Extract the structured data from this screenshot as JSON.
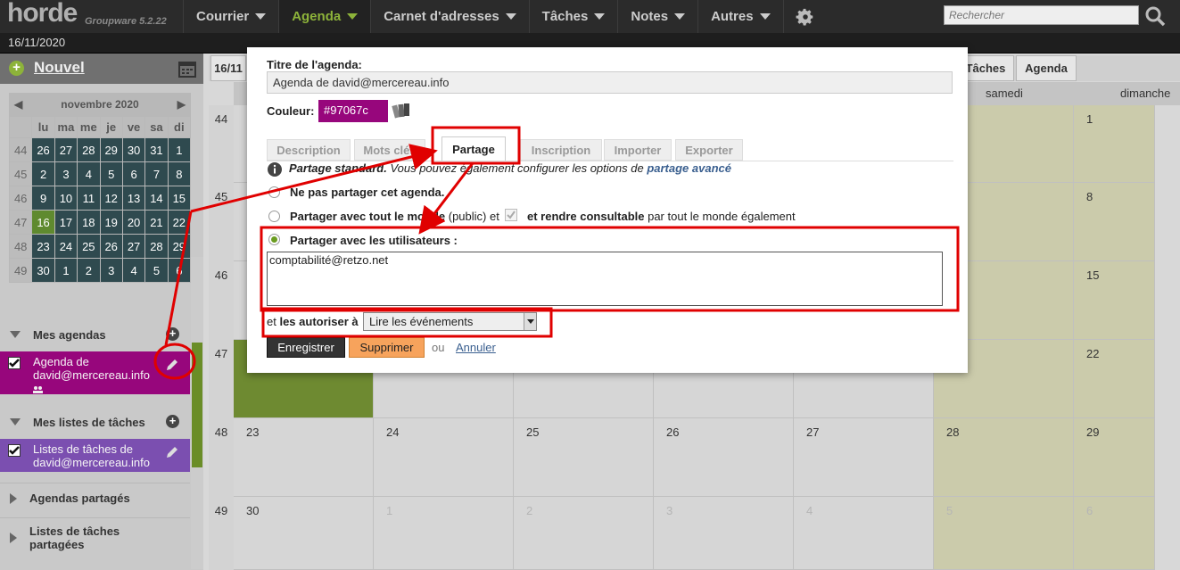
{
  "app": {
    "logo": "horde",
    "version": "Groupware 5.2.22",
    "date": "16/11/2020"
  },
  "menu": [
    {
      "label": "Courrier",
      "active": false
    },
    {
      "label": "Agenda",
      "active": true
    },
    {
      "label": "Carnet d'adresses",
      "active": false
    },
    {
      "label": "Tâches",
      "active": false
    },
    {
      "label": "Notes",
      "active": false
    },
    {
      "label": "Autres",
      "active": false
    }
  ],
  "search": {
    "placeholder": "Rechercher"
  },
  "sidebar": {
    "new_label": "Nouvel",
    "minical": {
      "month": "novembre 2020",
      "days": [
        "lu",
        "ma",
        "me",
        "je",
        "ve",
        "sa",
        "di"
      ],
      "weeks": [
        {
          "wk": "44",
          "d": [
            "26",
            "27",
            "28",
            "29",
            "30",
            "31",
            "1"
          ]
        },
        {
          "wk": "45",
          "d": [
            "2",
            "3",
            "4",
            "5",
            "6",
            "7",
            "8"
          ]
        },
        {
          "wk": "46",
          "d": [
            "9",
            "10",
            "11",
            "12",
            "13",
            "14",
            "15"
          ]
        },
        {
          "wk": "47",
          "d": [
            "16",
            "17",
            "18",
            "19",
            "20",
            "21",
            "22"
          ]
        },
        {
          "wk": "48",
          "d": [
            "23",
            "24",
            "25",
            "26",
            "27",
            "28",
            "29"
          ]
        },
        {
          "wk": "49",
          "d": [
            "30",
            "1",
            "2",
            "3",
            "4",
            "5",
            "6"
          ]
        }
      ]
    },
    "my_calendars": "Mes agendas",
    "calendar_item": "Agenda de david@mercereau.info",
    "my_tasklists": "Mes listes de tâches",
    "tasklist_item": "Listes de tâches de david@mercereau.info",
    "shared_calendars": "Agendas partagés",
    "shared_tasklists": "Listes de tâches partagées"
  },
  "calendar": {
    "view_tabs": [
      "16/11",
      "Tâches",
      "Agenda"
    ],
    "day_names": [
      "samedi",
      "dimanche"
    ],
    "weeks": [
      {
        "wk": "44",
        "days": [
          "",
          "",
          "",
          "",
          "",
          "",
          "1"
        ]
      },
      {
        "wk": "45",
        "days": [
          "",
          "",
          "",
          "",
          "",
          "",
          "8"
        ]
      },
      {
        "wk": "46",
        "days": [
          "",
          "",
          "",
          "",
          "",
          "",
          "15"
        ]
      },
      {
        "wk": "47",
        "days": [
          "",
          "",
          "",
          "",
          "",
          "",
          "22"
        ]
      },
      {
        "wk": "48",
        "days": [
          "23",
          "24",
          "25",
          "26",
          "27",
          "28",
          "29"
        ]
      },
      {
        "wk": "49",
        "days": [
          "30",
          "1",
          "2",
          "3",
          "4",
          "5",
          "6"
        ]
      }
    ]
  },
  "dialog": {
    "title_label": "Titre de l'agenda:",
    "title_value": "Agenda de david@mercereau.info",
    "color_label": "Couleur:",
    "color_value": "#97067c",
    "tabs": [
      "Description",
      "Mots clés",
      "Partage",
      "Inscription",
      "Importer",
      "Exporter"
    ],
    "info_bold": "Partage standard.",
    "info_text": " Vous pouvez également configurer les options de ",
    "info_link": "partage avancé",
    "opt_none": "Ne pas partager cet agenda.",
    "opt_public_bold": "Partager avec tout le monde",
    "opt_public_mid": " (public) et ",
    "opt_public_bold2": "et rendre consultable",
    "opt_public_end": " par tout le monde également",
    "opt_users": "Partager avec les utilisateurs :",
    "users_value": "comptabilité@retzo.net",
    "allow_pre": "et ",
    "allow_bold": "les autoriser à",
    "allow_value": "Lire les événements",
    "save": "Enregistrer",
    "delete": "Supprimer",
    "or": "ou",
    "cancel": "Annuler"
  },
  "colors": {
    "accent": "#8db33a",
    "calendar": "#97067c",
    "tasklist": "#7b4fb0",
    "annotation": "#e00000"
  }
}
